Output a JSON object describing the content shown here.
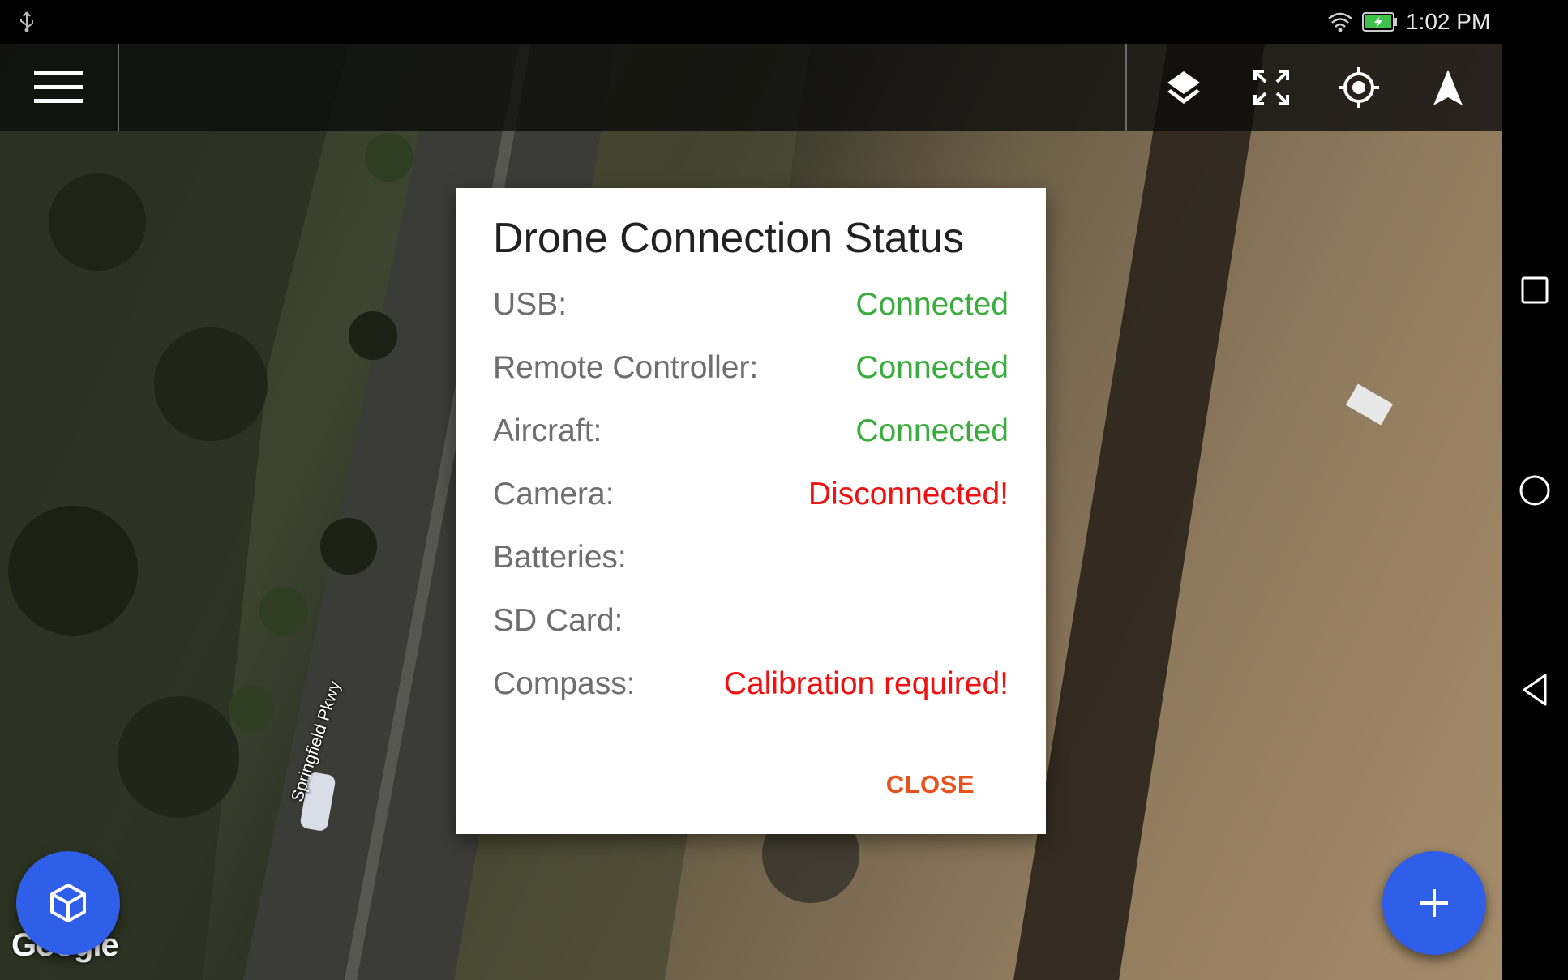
{
  "status_bar": {
    "time": "1:02 PM",
    "icons": [
      "usb-icon",
      "wifi-icon",
      "battery-charging-icon"
    ]
  },
  "map": {
    "street_label": "Springfield Pkwy",
    "attribution": "Google"
  },
  "toolbar": {
    "left_icons": [
      "menu-icon"
    ],
    "right_icons": [
      "layers-icon",
      "fullscreen-icon",
      "my-location-icon",
      "navigation-icon"
    ]
  },
  "dialog": {
    "title": "Drone Connection Status",
    "rows": [
      {
        "label": "USB:",
        "value": "Connected",
        "status": "ok"
      },
      {
        "label": "Remote Controller:",
        "value": "Connected",
        "status": "ok"
      },
      {
        "label": "Aircraft:",
        "value": "Connected",
        "status": "ok"
      },
      {
        "label": "Camera:",
        "value": "Disconnected!",
        "status": "error"
      },
      {
        "label": "Batteries:",
        "value": "",
        "status": "none"
      },
      {
        "label": "SD Card:",
        "value": "",
        "status": "none"
      },
      {
        "label": "Compass:",
        "value": "Calibration required!",
        "status": "error"
      }
    ],
    "close_label": "CLOSE"
  },
  "fabs": {
    "left_icon": "cube-icon",
    "right_icon": "plus-icon"
  },
  "nav_bar": {
    "icons": [
      "recents-icon",
      "home-icon",
      "back-icon"
    ]
  },
  "colors": {
    "connected": "#3aad3e",
    "error": "#f01010",
    "close": "#e8531d",
    "fab": "#2f5ee8"
  }
}
